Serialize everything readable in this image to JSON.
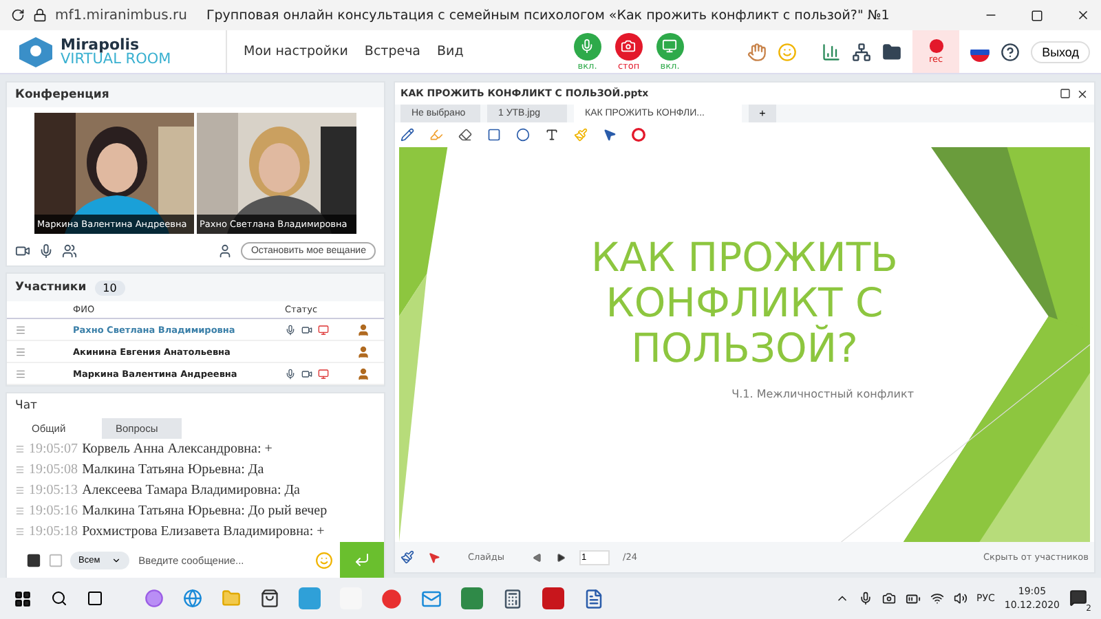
{
  "browser": {
    "url": "mf1.miranimbus.ru",
    "title": "Групповая онлайн консультация с семейным психологом «Как прожить конфликт с пользой?\" №1"
  },
  "header": {
    "logo_top": "Mirapolis",
    "logo_bottom": "VIRTUAL ROOM",
    "menu": [
      "Мои настройки",
      "Встреча",
      "Вид"
    ],
    "controls": [
      {
        "kind": "mic",
        "label": "вкл."
      },
      {
        "kind": "camera",
        "label": "стоп"
      },
      {
        "kind": "screen",
        "label": "вкл."
      }
    ],
    "rec": "rec",
    "exit": "Выход"
  },
  "conference": {
    "title": "Конференция",
    "videos": [
      {
        "kind": "picture",
        "name": "Маркина Валентина  Андреевна"
      },
      {
        "kind": "picture",
        "name": "Рахно Светлана  Владимировна"
      }
    ],
    "stop_button": "Остановить мое вещание"
  },
  "participants": {
    "title": "Участники",
    "count": "10",
    "columns": [
      "ФИО",
      "Статус"
    ],
    "rows": [
      {
        "name": "Рахно Светлана  Владимировна",
        "selected": true,
        "status_icons": true
      },
      {
        "name": "Акинина  Евгения Анатольевна",
        "selected": false,
        "status_icons": false
      },
      {
        "name": "Маркина Валентина  Андреевна",
        "selected": false,
        "status_icons": true
      }
    ]
  },
  "chat": {
    "title": "Чат",
    "tabs": [
      {
        "label": "Общий",
        "selected": true
      },
      {
        "label": "Вопросы",
        "selected": false
      }
    ],
    "messages": [
      {
        "time": "19:05:07",
        "text": "Корвель Анна  Александровна: +"
      },
      {
        "time": "19:05:08",
        "text": "Малкина Татьяна  Юрьевна: Да"
      },
      {
        "time": "19:05:13",
        "text": "Алексеева   Тамара  Владимировна: Да"
      },
      {
        "time": "19:05:16",
        "text": "Малкина Татьяна  Юрьевна: До рый вечер"
      },
      {
        "time": "19:05:18",
        "text": "Рохмистрова  Елизавета Владимировна: +"
      }
    ],
    "audience": "Всем",
    "placeholder": "Введите сообщение..."
  },
  "presentation": {
    "title": "КАК ПРОЖИТЬ КОНФЛИКТ С ПОЛЬЗОЙ.pptx",
    "tabs": [
      {
        "label": "Не выбрано",
        "selected": false
      },
      {
        "label": "1 УТВ.jpg",
        "selected": false
      },
      {
        "label": "КАК ПРОЖИТЬ КОНФЛИ...",
        "selected": true
      }
    ],
    "add_tab": "+",
    "slide": {
      "title_lines": [
        "КАК ПРОЖИТЬ",
        "КОНФЛИКТ С",
        "ПОЛЬЗОЙ?"
      ],
      "subtitle": "Ч.1. Межличностный конфликт"
    },
    "slides_label": "Слайды",
    "page": "1",
    "total": "/24",
    "hide": "Скрыть от участников"
  },
  "taskbar": {
    "language": "РУС",
    "time": "19:05",
    "date": "10.12.2020",
    "notifications": "2"
  }
}
